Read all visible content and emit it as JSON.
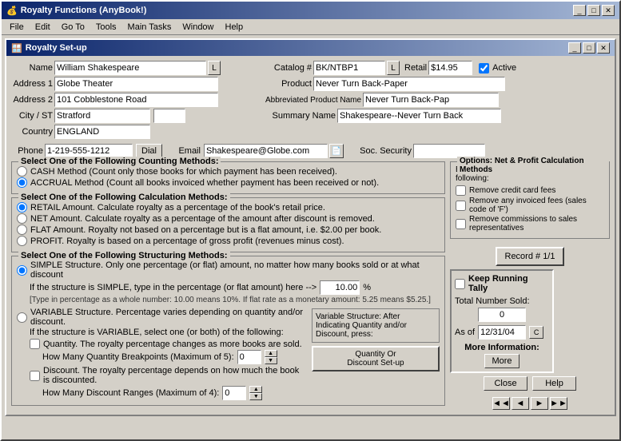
{
  "outer_window": {
    "title": "Royalty Functions (AnyBook!)",
    "icon": "💰"
  },
  "menu": {
    "items": [
      "File",
      "Edit",
      "Go To",
      "Tools",
      "Main Tasks",
      "Window",
      "Help"
    ]
  },
  "inner_window": {
    "title": "Royalty Set-up",
    "icon": "🪟"
  },
  "form": {
    "name_label": "Name",
    "name_value": "William Shakespeare",
    "address1_label": "Address 1",
    "address1_value": "Globe Theater",
    "address2_label": "Address 2",
    "address2_value": "101 Cobblestone Road",
    "city_st_label": "City / ST",
    "city_st_value": "Stratford",
    "country_label": "Country",
    "country_value": "ENGLAND",
    "phone_label": "Phone",
    "phone_value": "1-219-555-1212",
    "dial_btn": "Dial",
    "email_label": "Email",
    "email_value": "Shakespeare@Globe.com",
    "soc_sec_label": "Soc. Security",
    "soc_sec_value": "",
    "catalog_label": "Catalog #",
    "catalog_value": "BK/NTBP1",
    "retail_label": "Retail",
    "retail_value": "$14.95",
    "active_label": "Active",
    "product_label": "Product",
    "product_value": "Never Turn Back-Paper",
    "abbrev_label": "Abbreviated Product Name",
    "abbrev_value": "Never Turn Back-Pap",
    "summary_label": "Summary Name",
    "summary_value": "Shakespeare--Never Turn Back",
    "l_btn": "L"
  },
  "counting_methods": {
    "title": "Select One of the Following Counting Methods:",
    "options": [
      "CASH Method (Count only those books for which payment has been received).",
      "ACCRUAL Method (Count all books invoiced whether payment has been received or not)."
    ],
    "selected": 1
  },
  "calculation_methods": {
    "title": "Select One of the Following Calculation Methods:",
    "options": [
      "RETAIL Amount.  Calculate royalty as a percentage of the book's retail price.",
      "NET Amount.  Calculate royalty as a percentage of the amount after discount is removed.",
      "FLAT Amount.  Royalty not based on a percentage but is a flat amount, i.e. $2.00 per book.",
      "PROFIT.  Royalty is based on a percentage of gross profit (revenues minus cost)."
    ],
    "selected": 0
  },
  "structuring_methods": {
    "title": "Select One of the Following Structuring Methods:",
    "simple_label": "SIMPLE Structure.  Only one percentage (or flat) amount, no matter how many books sold or at what discount",
    "simple_hint1": "If the structure is SIMPLE, type in the percentage (or flat amount) here -->",
    "simple_value": "10.00",
    "simple_pct": "%",
    "simple_hint2": "[Type in percentage as a whole number: 10.00 means 10%.  If flat rate as a monetary amount: 5.25 means $5.25.]",
    "variable_label": "VARIABLE Structure.  Percentage varies depending on quantity and/or discount.",
    "variable_hint": "If the structure is VARIABLE, select one (or both) of the following:",
    "qty_check": "Quantity.  The royalty percentage changes as more books are sold.",
    "qty_breakpoints_label": "How Many Quantity Breakpoints (Maximum of 5):",
    "qty_breakpoints_value": "0",
    "discount_check": "Discount.  The royalty percentage depends on how much the book is discounted.",
    "discount_ranges_label": "How Many Discount Ranges (Maximum of 4):",
    "discount_ranges_value": "0",
    "selected": "simple"
  },
  "net_profit": {
    "title": "Options: Net & Profit Calculation Methods",
    "subtitle": "Before calculating royalties, remove the following:",
    "options": [
      "Remove credit card fees",
      "Remove any invoiced fees (sales code of 'F')",
      "Remove commissions to sales representatives"
    ]
  },
  "record": {
    "label": "Record # 1/1"
  },
  "tally": {
    "title": "Keep Running Tally",
    "total_label": "Total Number Sold:",
    "total_value": "0",
    "as_of_label": "As of",
    "as_of_value": "12/31/04",
    "more_label": "More Information:",
    "more_btn": "More"
  },
  "buttons": {
    "close": "Close",
    "help": "Help",
    "qty_discount": "Quantity Or\nDiscount Set-up",
    "nav_first": "◄◄",
    "nav_prev": "◄",
    "nav_next": "►",
    "nav_last": "►►"
  },
  "variable_structure_box": {
    "text": "Variable Structure: After Indicating Quantity and/or Discount, press:"
  }
}
